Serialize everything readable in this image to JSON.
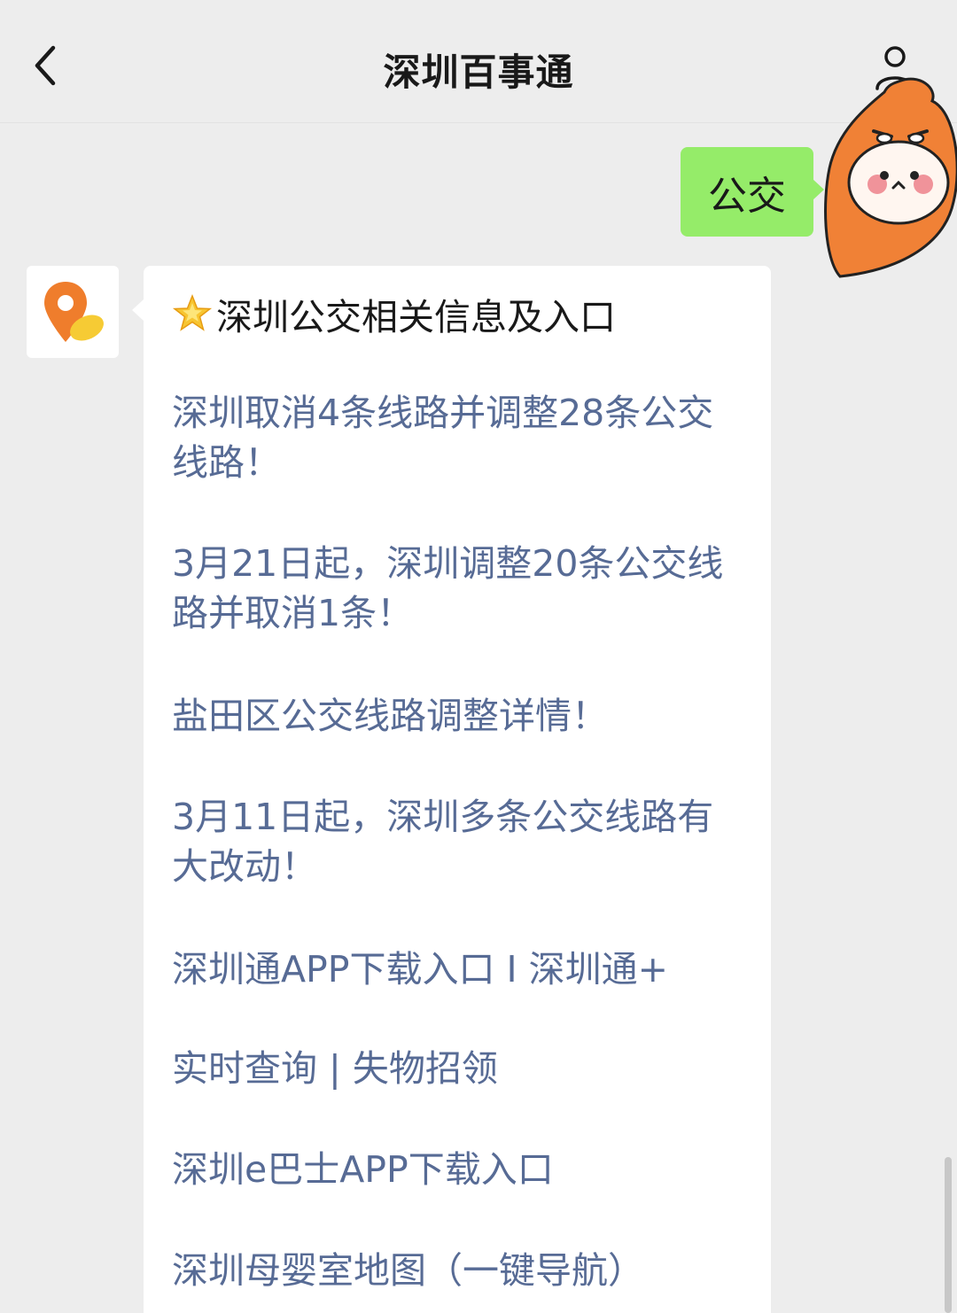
{
  "header": {
    "title": "深圳百事通"
  },
  "chat": {
    "user_message": "公交",
    "bot_heading": "深圳公交相关信息及入口",
    "links": [
      "深圳取消4条线路并调整28条公交线路！",
      "3月21日起，深圳调整20条公交线路并取消1条！",
      "盐田区公交线路调整详情！",
      "3月11日起，深圳多条公交线路有大改动！",
      "深圳通APP下载入口 I 深圳通+",
      "实时查询 | 失物招领",
      "深圳e巴士APP下载入口",
      "深圳母婴室地图（一键导航）"
    ]
  },
  "icons": {
    "back": "chevron-left-icon",
    "profile": "person-icon",
    "heading": "star-icon",
    "bot_avatar": "location-pin-icon"
  },
  "colors": {
    "background": "#ededed",
    "user_bubble": "#95ec69",
    "link": "#576b95",
    "avatar_orange": "#f08136"
  }
}
